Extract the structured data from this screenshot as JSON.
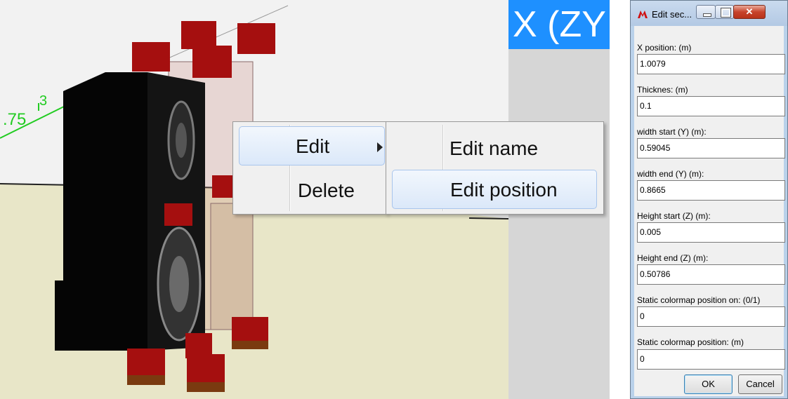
{
  "viewport": {
    "axis_labels": [
      "3",
      ".75"
    ],
    "view_tab": "X (ZY"
  },
  "context_menu": {
    "items": [
      {
        "label": "Edit",
        "has_submenu": true
      },
      {
        "label": "Delete"
      }
    ],
    "submenu": [
      {
        "label": "Edit name"
      },
      {
        "label": "Edit position"
      }
    ]
  },
  "dialog": {
    "title": "Edit sec...",
    "fields": [
      {
        "label": "X position: (m)",
        "value": "1.0079"
      },
      {
        "label": "Thicknes: (m)",
        "value": "0.1"
      },
      {
        "label": "width start (Y) (m):",
        "value": "0.59045"
      },
      {
        "label": "width end (Y) (m):",
        "value": "0.8665"
      },
      {
        "label": "Height start (Z) (m):",
        "value": "0.005"
      },
      {
        "label": "Height end (Z) (m):",
        "value": "0.50786"
      },
      {
        "label": "Static colormap position on: (0/1)",
        "value": "0"
      },
      {
        "label": "Static colormap position: (m)",
        "value": "0"
      }
    ],
    "ok_label": "OK",
    "cancel_label": "Cancel"
  },
  "colors": {
    "accent_tab": "#1e90ff",
    "handle_red": "#a50f0f",
    "axis_green": "#22cc22",
    "floor": "#e8e6c8"
  }
}
